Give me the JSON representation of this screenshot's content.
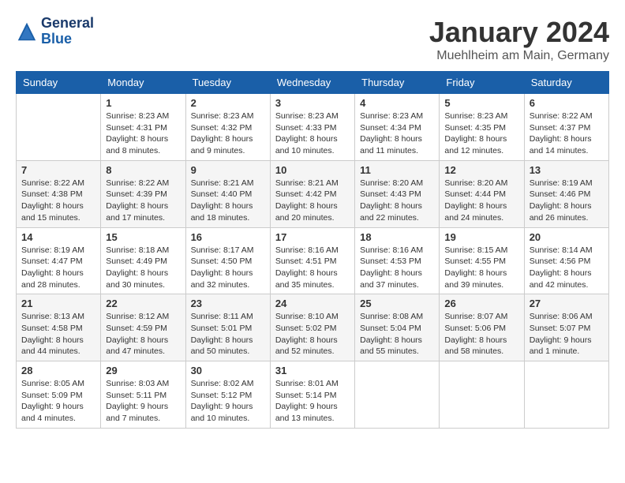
{
  "header": {
    "logo_line1": "General",
    "logo_line2": "Blue",
    "month_year": "January 2024",
    "location": "Muehlheim am Main, Germany"
  },
  "weekdays": [
    "Sunday",
    "Monday",
    "Tuesday",
    "Wednesday",
    "Thursday",
    "Friday",
    "Saturday"
  ],
  "weeks": [
    [
      {
        "day": "",
        "info": ""
      },
      {
        "day": "1",
        "info": "Sunrise: 8:23 AM\nSunset: 4:31 PM\nDaylight: 8 hours\nand 8 minutes."
      },
      {
        "day": "2",
        "info": "Sunrise: 8:23 AM\nSunset: 4:32 PM\nDaylight: 8 hours\nand 9 minutes."
      },
      {
        "day": "3",
        "info": "Sunrise: 8:23 AM\nSunset: 4:33 PM\nDaylight: 8 hours\nand 10 minutes."
      },
      {
        "day": "4",
        "info": "Sunrise: 8:23 AM\nSunset: 4:34 PM\nDaylight: 8 hours\nand 11 minutes."
      },
      {
        "day": "5",
        "info": "Sunrise: 8:23 AM\nSunset: 4:35 PM\nDaylight: 8 hours\nand 12 minutes."
      },
      {
        "day": "6",
        "info": "Sunrise: 8:22 AM\nSunset: 4:37 PM\nDaylight: 8 hours\nand 14 minutes."
      }
    ],
    [
      {
        "day": "7",
        "info": "Sunrise: 8:22 AM\nSunset: 4:38 PM\nDaylight: 8 hours\nand 15 minutes."
      },
      {
        "day": "8",
        "info": "Sunrise: 8:22 AM\nSunset: 4:39 PM\nDaylight: 8 hours\nand 17 minutes."
      },
      {
        "day": "9",
        "info": "Sunrise: 8:21 AM\nSunset: 4:40 PM\nDaylight: 8 hours\nand 18 minutes."
      },
      {
        "day": "10",
        "info": "Sunrise: 8:21 AM\nSunset: 4:42 PM\nDaylight: 8 hours\nand 20 minutes."
      },
      {
        "day": "11",
        "info": "Sunrise: 8:20 AM\nSunset: 4:43 PM\nDaylight: 8 hours\nand 22 minutes."
      },
      {
        "day": "12",
        "info": "Sunrise: 8:20 AM\nSunset: 4:44 PM\nDaylight: 8 hours\nand 24 minutes."
      },
      {
        "day": "13",
        "info": "Sunrise: 8:19 AM\nSunset: 4:46 PM\nDaylight: 8 hours\nand 26 minutes."
      }
    ],
    [
      {
        "day": "14",
        "info": "Sunrise: 8:19 AM\nSunset: 4:47 PM\nDaylight: 8 hours\nand 28 minutes."
      },
      {
        "day": "15",
        "info": "Sunrise: 8:18 AM\nSunset: 4:49 PM\nDaylight: 8 hours\nand 30 minutes."
      },
      {
        "day": "16",
        "info": "Sunrise: 8:17 AM\nSunset: 4:50 PM\nDaylight: 8 hours\nand 32 minutes."
      },
      {
        "day": "17",
        "info": "Sunrise: 8:16 AM\nSunset: 4:51 PM\nDaylight: 8 hours\nand 35 minutes."
      },
      {
        "day": "18",
        "info": "Sunrise: 8:16 AM\nSunset: 4:53 PM\nDaylight: 8 hours\nand 37 minutes."
      },
      {
        "day": "19",
        "info": "Sunrise: 8:15 AM\nSunset: 4:55 PM\nDaylight: 8 hours\nand 39 minutes."
      },
      {
        "day": "20",
        "info": "Sunrise: 8:14 AM\nSunset: 4:56 PM\nDaylight: 8 hours\nand 42 minutes."
      }
    ],
    [
      {
        "day": "21",
        "info": "Sunrise: 8:13 AM\nSunset: 4:58 PM\nDaylight: 8 hours\nand 44 minutes."
      },
      {
        "day": "22",
        "info": "Sunrise: 8:12 AM\nSunset: 4:59 PM\nDaylight: 8 hours\nand 47 minutes."
      },
      {
        "day": "23",
        "info": "Sunrise: 8:11 AM\nSunset: 5:01 PM\nDaylight: 8 hours\nand 50 minutes."
      },
      {
        "day": "24",
        "info": "Sunrise: 8:10 AM\nSunset: 5:02 PM\nDaylight: 8 hours\nand 52 minutes."
      },
      {
        "day": "25",
        "info": "Sunrise: 8:08 AM\nSunset: 5:04 PM\nDaylight: 8 hours\nand 55 minutes."
      },
      {
        "day": "26",
        "info": "Sunrise: 8:07 AM\nSunset: 5:06 PM\nDaylight: 8 hours\nand 58 minutes."
      },
      {
        "day": "27",
        "info": "Sunrise: 8:06 AM\nSunset: 5:07 PM\nDaylight: 9 hours\nand 1 minute."
      }
    ],
    [
      {
        "day": "28",
        "info": "Sunrise: 8:05 AM\nSunset: 5:09 PM\nDaylight: 9 hours\nand 4 minutes."
      },
      {
        "day": "29",
        "info": "Sunrise: 8:03 AM\nSunset: 5:11 PM\nDaylight: 9 hours\nand 7 minutes."
      },
      {
        "day": "30",
        "info": "Sunrise: 8:02 AM\nSunset: 5:12 PM\nDaylight: 9 hours\nand 10 minutes."
      },
      {
        "day": "31",
        "info": "Sunrise: 8:01 AM\nSunset: 5:14 PM\nDaylight: 9 hours\nand 13 minutes."
      },
      {
        "day": "",
        "info": ""
      },
      {
        "day": "",
        "info": ""
      },
      {
        "day": "",
        "info": ""
      }
    ]
  ]
}
